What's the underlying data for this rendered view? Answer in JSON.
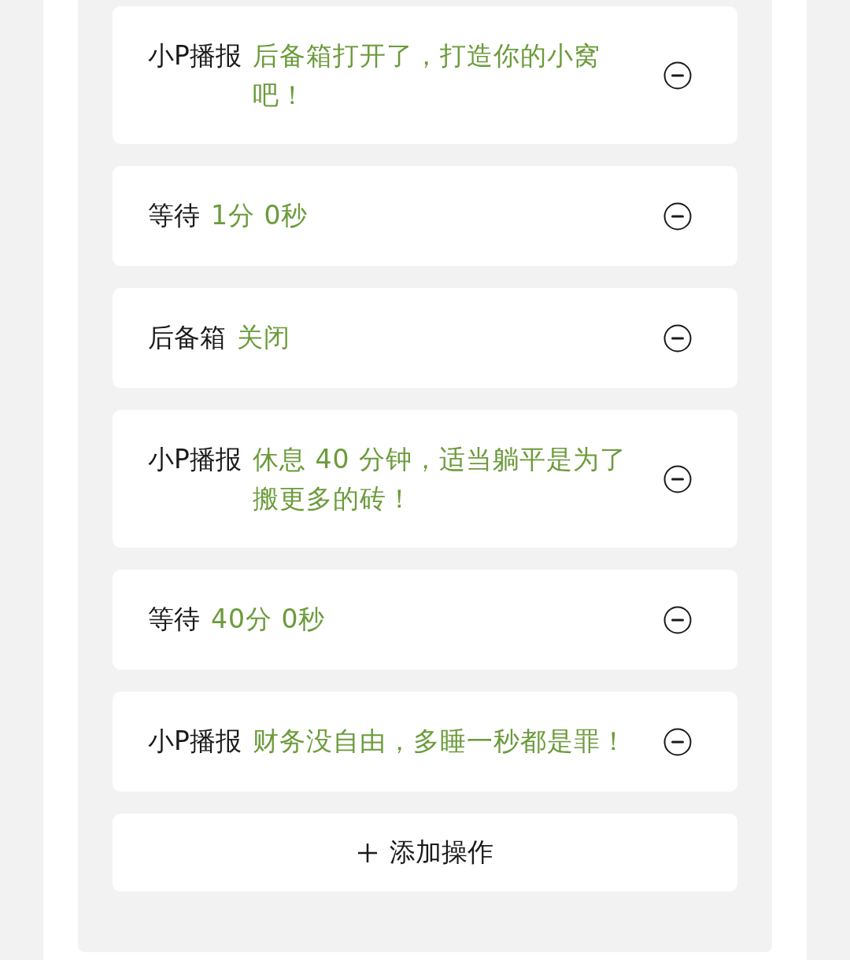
{
  "actions": [
    {
      "label": "小P播报",
      "value": "后备箱打开了，打造你的小窝吧！"
    },
    {
      "label": "等待",
      "value": "1分 0秒"
    },
    {
      "label": "后备箱",
      "value": "关闭"
    },
    {
      "label": "小P播报",
      "value": "休息 40 分钟，适当躺平是为了搬更多的砖！"
    },
    {
      "label": "等待",
      "value": "40分 0秒"
    },
    {
      "label": "小P播报",
      "value": "财务没自由，多睡一秒都是罪！"
    }
  ],
  "add_button": {
    "label": "添加操作"
  }
}
